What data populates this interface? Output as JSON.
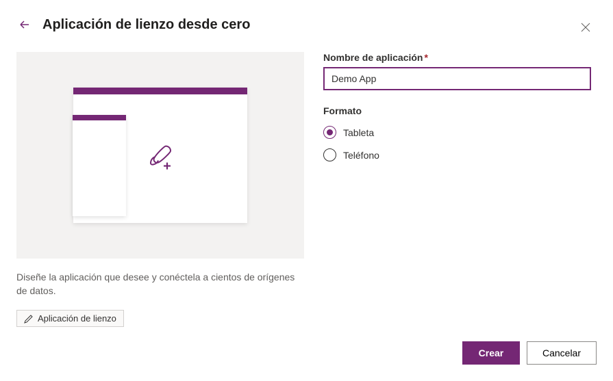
{
  "header": {
    "title": "Aplicación de lienzo desde cero"
  },
  "preview": {
    "description": "Diseñe la aplicación que desee y conéctela a cientos de orígenes de datos.",
    "badge_label": "Aplicación de lienzo"
  },
  "form": {
    "name_label": "Nombre de aplicación",
    "name_value": "Demo App",
    "format_label": "Formato",
    "options": {
      "tablet": "Tableta",
      "phone": "Teléfono"
    },
    "selected": "tablet"
  },
  "footer": {
    "create": "Crear",
    "cancel": "Cancelar"
  },
  "colors": {
    "accent": "#742774"
  }
}
